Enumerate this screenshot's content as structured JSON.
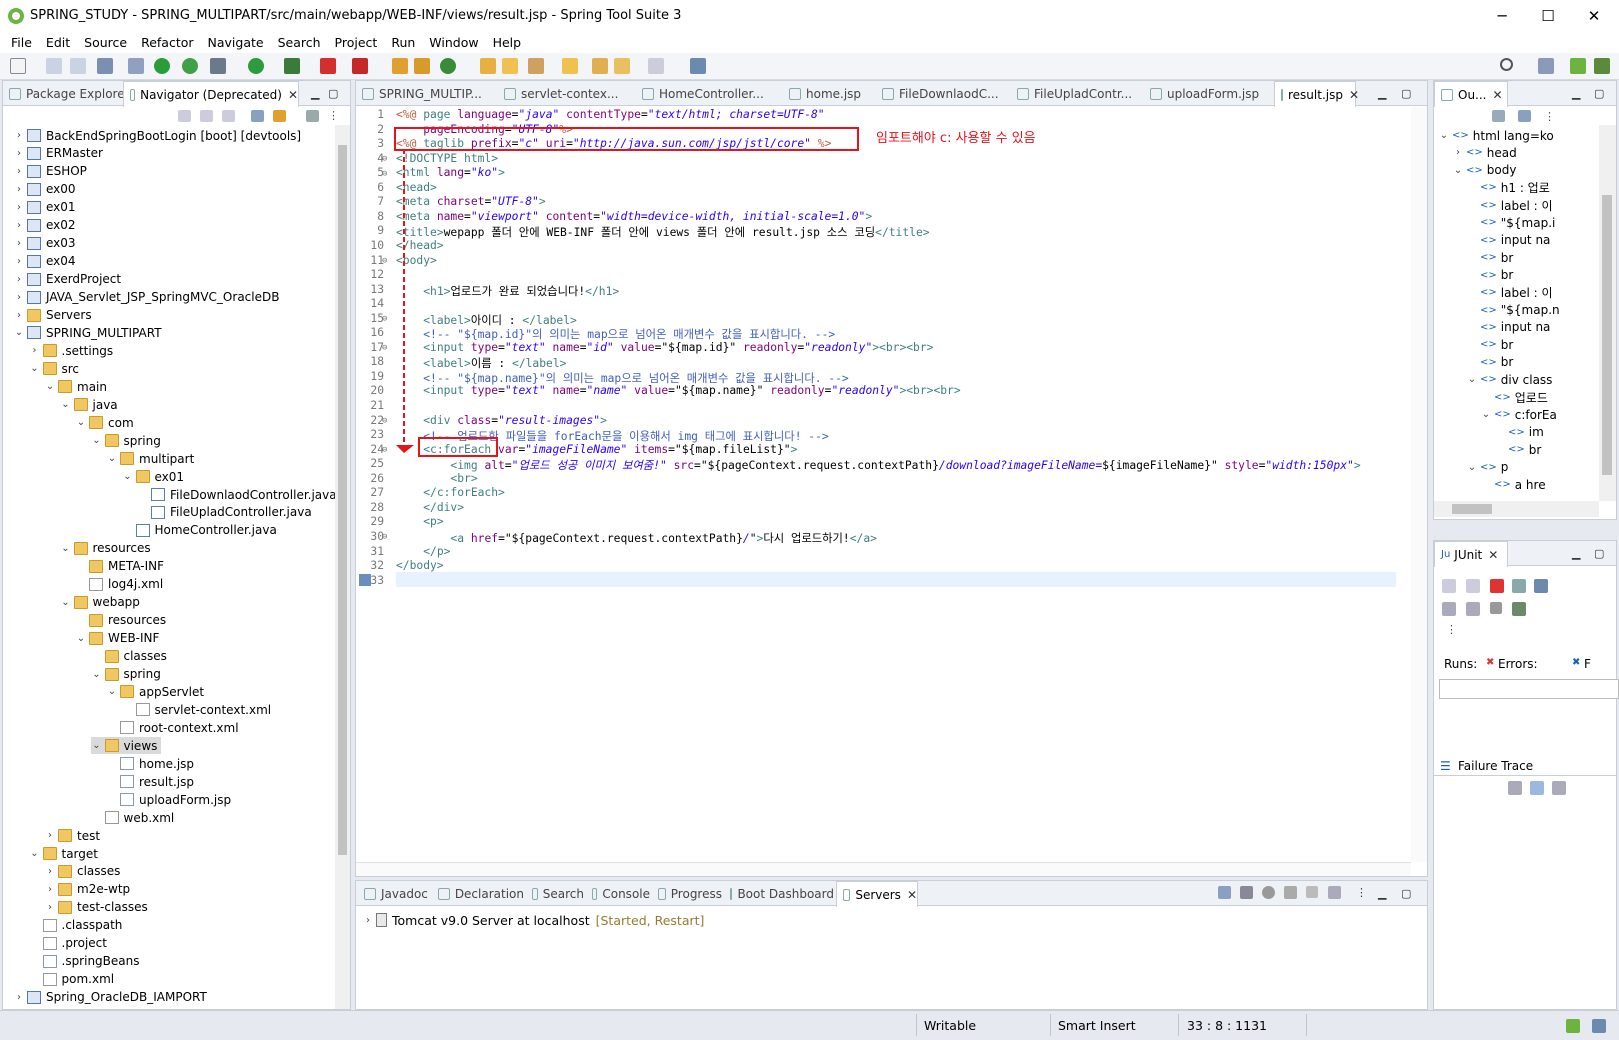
{
  "window": {
    "title": "SPRING_STUDY - SPRING_MULTIPART/src/main/webapp/WEB-INF/views/result.jsp - Spring Tool Suite 3",
    "min": "─",
    "max": "☐",
    "close": "✕"
  },
  "menu": [
    "File",
    "Edit",
    "Source",
    "Refactor",
    "Navigate",
    "Search",
    "Project",
    "Run",
    "Window",
    "Help"
  ],
  "left_panel": {
    "tabs": [
      {
        "label": "Package Explorer"
      },
      {
        "label": "Navigator (Deprecated)"
      }
    ],
    "tree": [
      {
        "label": "BackEndSpringBootLogin [boot] [devtools]",
        "depth": 0,
        "icon": "proj",
        "chev": "›"
      },
      {
        "label": "ERMaster",
        "depth": 0,
        "icon": "proj",
        "chev": "›"
      },
      {
        "label": "ESHOP",
        "depth": 0,
        "icon": "proj",
        "chev": "›"
      },
      {
        "label": "ex00",
        "depth": 0,
        "icon": "proj",
        "chev": "›"
      },
      {
        "label": "ex01",
        "depth": 0,
        "icon": "proj",
        "chev": "›"
      },
      {
        "label": "ex02",
        "depth": 0,
        "icon": "proj",
        "chev": "›"
      },
      {
        "label": "ex03",
        "depth": 0,
        "icon": "proj",
        "chev": "›"
      },
      {
        "label": "ex04",
        "depth": 0,
        "icon": "proj",
        "chev": "›"
      },
      {
        "label": "ExerdProject",
        "depth": 0,
        "icon": "proj",
        "chev": "›"
      },
      {
        "label": "JAVA_Servlet_JSP_SpringMVC_OracleDB",
        "depth": 0,
        "icon": "proj",
        "chev": "›"
      },
      {
        "label": "Servers",
        "depth": 0,
        "icon": "folder",
        "chev": "›"
      },
      {
        "label": "SPRING_MULTIPART",
        "depth": 0,
        "icon": "proj",
        "chev": "⌄"
      },
      {
        "label": ".settings",
        "depth": 1,
        "icon": "folder",
        "chev": "›"
      },
      {
        "label": "src",
        "depth": 1,
        "icon": "folder",
        "chev": "⌄"
      },
      {
        "label": "main",
        "depth": 2,
        "icon": "folder",
        "chev": "⌄"
      },
      {
        "label": "java",
        "depth": 3,
        "icon": "folder",
        "chev": "⌄"
      },
      {
        "label": "com",
        "depth": 4,
        "icon": "folder",
        "chev": "⌄"
      },
      {
        "label": "spring",
        "depth": 5,
        "icon": "folder",
        "chev": "⌄"
      },
      {
        "label": "multipart",
        "depth": 6,
        "icon": "folder",
        "chev": "⌄"
      },
      {
        "label": "ex01",
        "depth": 7,
        "icon": "folder",
        "chev": "⌄"
      },
      {
        "label": "FileDownlaodController.java",
        "depth": 8,
        "icon": "java",
        "chev": ""
      },
      {
        "label": "FileUpladController.java",
        "depth": 8,
        "icon": "java",
        "chev": ""
      },
      {
        "label": "HomeController.java",
        "depth": 7,
        "icon": "java",
        "chev": ""
      },
      {
        "label": "resources",
        "depth": 3,
        "icon": "folder",
        "chev": "⌄"
      },
      {
        "label": "META-INF",
        "depth": 4,
        "icon": "folder",
        "chev": ""
      },
      {
        "label": "log4j.xml",
        "depth": 4,
        "icon": "xml",
        "chev": ""
      },
      {
        "label": "webapp",
        "depth": 3,
        "icon": "folder",
        "chev": "⌄"
      },
      {
        "label": "resources",
        "depth": 4,
        "icon": "folder",
        "chev": ""
      },
      {
        "label": "WEB-INF",
        "depth": 4,
        "icon": "folder",
        "chev": "⌄"
      },
      {
        "label": "classes",
        "depth": 5,
        "icon": "folder",
        "chev": ""
      },
      {
        "label": "spring",
        "depth": 5,
        "icon": "folder",
        "chev": "⌄"
      },
      {
        "label": "appServlet",
        "depth": 6,
        "icon": "folder",
        "chev": "⌄"
      },
      {
        "label": "servlet-context.xml",
        "depth": 7,
        "icon": "xml",
        "chev": ""
      },
      {
        "label": "root-context.xml",
        "depth": 6,
        "icon": "xml",
        "chev": ""
      },
      {
        "label": "views",
        "depth": 5,
        "icon": "folder",
        "chev": "⌄",
        "selected": true
      },
      {
        "label": "home.jsp",
        "depth": 6,
        "icon": "file",
        "chev": ""
      },
      {
        "label": "result.jsp",
        "depth": 6,
        "icon": "file",
        "chev": ""
      },
      {
        "label": "uploadForm.jsp",
        "depth": 6,
        "icon": "file",
        "chev": ""
      },
      {
        "label": "web.xml",
        "depth": 5,
        "icon": "xml",
        "chev": ""
      },
      {
        "label": "test",
        "depth": 2,
        "icon": "folder",
        "chev": "›"
      },
      {
        "label": "target",
        "depth": 1,
        "icon": "folder",
        "chev": "⌄"
      },
      {
        "label": "classes",
        "depth": 2,
        "icon": "folder",
        "chev": "›"
      },
      {
        "label": "m2e-wtp",
        "depth": 2,
        "icon": "folder",
        "chev": "›"
      },
      {
        "label": "test-classes",
        "depth": 2,
        "icon": "folder",
        "chev": "›"
      },
      {
        "label": ".classpath",
        "depth": 1,
        "icon": "xml",
        "chev": ""
      },
      {
        "label": ".project",
        "depth": 1,
        "icon": "xml",
        "chev": ""
      },
      {
        "label": ".springBeans",
        "depth": 1,
        "icon": "file",
        "chev": ""
      },
      {
        "label": "pom.xml",
        "depth": 1,
        "icon": "xml",
        "chev": ""
      },
      {
        "label": "Spring_OracleDB_IAMPORT",
        "depth": 0,
        "icon": "proj",
        "chev": "›"
      }
    ]
  },
  "editor": {
    "tabs": [
      "SPRING_MULTIP...",
      "servlet-contex...",
      "HomeController...",
      "home.jsp",
      "FileDownlaodC...",
      "FileUpladContr...",
      "uploadForm.jsp",
      "result.jsp"
    ],
    "active_tab": "result.jsp",
    "annotation": "임포트해야 c: 사용할 수 있음",
    "annotation_color": "#e8121b",
    "lines": [
      {
        "n": "1",
        "html": "<span class='jsp'>&lt;%@</span> <span class='tag'>page</span> <span class='attr'>language</span>=<span class='str'>\"java\"</span> <span class='attr'>contentType</span>=<span class='str'>\"text/html; charset=UTF-8\"</span>"
      },
      {
        "n": "2",
        "html": "    <span class='attr'>pageEncoding</span>=<span class='str'>\"UTF-8\"</span><span class='jsp'>%&gt;</span>"
      },
      {
        "n": "3",
        "html": "<span class='jsp'>&lt;%@</span> <span class='tag'>taglib</span> <span class='attr'>prefix</span>=<span class='str'>\"c\"</span> <span class='attr'>uri</span>=<span class='str'>\"http://java.sun.com/jsp/jstl/core\"</span> <span class='jsp'>%&gt;</span>"
      },
      {
        "n": "4",
        "html": "<span class='tag'>&lt;!DOCTYPE html&gt;</span>"
      },
      {
        "n": "5",
        "html": "<span class='tag'>&lt;html</span> <span class='attr'>lang</span>=<span class='str'>\"ko\"</span><span class='tag'>&gt;</span>"
      },
      {
        "n": "6",
        "html": "<span class='tag'>&lt;head&gt;</span>"
      },
      {
        "n": "7",
        "html": "<span class='tag'>&lt;meta</span> <span class='attr'>charset</span>=<span class='str'>\"UTF-8\"</span><span class='tag'>&gt;</span>"
      },
      {
        "n": "8",
        "html": "<span class='tag'>&lt;meta</span> <span class='attr'>name</span>=<span class='str'>\"viewport\"</span> <span class='attr'>content</span>=<span class='str'>\"width=device-width, initial-scale=1.0\"</span><span class='tag'>&gt;</span>"
      },
      {
        "n": "9",
        "html": "<span class='tag'>&lt;title&gt;</span>wepapp 폴더 안에 WEB-INF 폴더 안에 views 폴더 안에 result.jsp 소스 코딩<span class='tag'>&lt;/title&gt;</span>"
      },
      {
        "n": "10",
        "html": "<span class='tag'>&lt;/head&gt;</span>"
      },
      {
        "n": "11",
        "html": "<span class='tag'>&lt;body&gt;</span>"
      },
      {
        "n": "12",
        "html": ""
      },
      {
        "n": "13",
        "html": "    <span class='tag'>&lt;h1&gt;</span>업로드가 완료 되었습니다!<span class='tag'>&lt;/h1&gt;</span>"
      },
      {
        "n": "14",
        "html": ""
      },
      {
        "n": "15",
        "html": "    <span class='tag'>&lt;label&gt;</span>아이디 : <span class='tag'>&lt;/label&gt;</span>"
      },
      {
        "n": "16",
        "html": "    <span class='cmt'>&lt;!-- \"${map.id}\"의 의미는 map으로 넘어온 매개변수 값을 표시합니다. --&gt;</span>"
      },
      {
        "n": "17",
        "html": "    <span class='tag'>&lt;input</span> <span class='attr'>type</span>=<span class='str'>\"text\"</span> <span class='attr'>name</span>=<span class='str'>\"id\"</span> <span class='attr'>value</span>=\"${map.id}\" <span class='attr'>readonly</span>=<span class='str'>\"readonly\"</span><span class='tag'>&gt;&lt;br&gt;&lt;br&gt;</span>"
      },
      {
        "n": "18",
        "html": "    <span class='tag'>&lt;label&gt;</span>이름 : <span class='tag'>&lt;/label&gt;</span>"
      },
      {
        "n": "19",
        "html": "    <span class='cmt'>&lt;!-- \"${map.name}\"의 의미는 map으로 넘어온 매개변수 값을 표시합니다. --&gt;</span>"
      },
      {
        "n": "20",
        "html": "    <span class='tag'>&lt;input</span> <span class='attr'>type</span>=<span class='str'>\"text\"</span> <span class='attr'>name</span>=<span class='str'>\"name\"</span> <span class='attr'>value</span>=\"${map.name}\" <span class='attr'>readonly</span>=<span class='str'>\"readonly\"</span><span class='tag'>&gt;&lt;br&gt;&lt;br&gt;</span>"
      },
      {
        "n": "21",
        "html": ""
      },
      {
        "n": "22",
        "html": "    <span class='tag'>&lt;div</span> <span class='attr'>class</span>=<span class='str'>\"result-images\"</span><span class='tag'>&gt;</span>"
      },
      {
        "n": "23",
        "html": "    <span class='cmt'>&lt;!-- 업로드한 파일들을 forEach문을 이용해서 img 태그에 표시합니다! --&gt;</span>"
      },
      {
        "n": "24",
        "html": "    <span class='tag'>&lt;c:forEach</span> <span class='attr'>var</span>=<span class='str'>\"imageFileName\"</span> <span class='attr'>items</span>=\"${map.fileList}\"<span class='tag'>&gt;</span>"
      },
      {
        "n": "25",
        "html": "        <span class='tag'>&lt;img</span> <span class='attr'>alt</span>=<span class='str'>\"업로드 성공 이미지 보여줌!\"</span> <span class='attr'>src</span>=\"${pageContext.request.contextPath}<span class='str'>/download?imageFileName=</span>${imageFileName}\" <span class='attr'>style</span>=<span class='str'>\"width:150px\"</span><span class='tag'>&gt;</span>"
      },
      {
        "n": "26",
        "html": "        <span class='tag'>&lt;br&gt;</span>"
      },
      {
        "n": "27",
        "html": "    <span class='tag'>&lt;/c:forEach&gt;</span>"
      },
      {
        "n": "28",
        "html": "    <span class='tag'>&lt;/div&gt;</span>"
      },
      {
        "n": "29",
        "html": "    <span class='tag'>&lt;p&gt;</span>"
      },
      {
        "n": "30",
        "html": "        <span class='tag'>&lt;a</span> <span class='attr'>href</span>=\"${pageContext.request.contextPath}<span class='str'>/</span>\"<span class='tag'>&gt;</span>다시 업로드하기!<span class='tag'>&lt;/a&gt;</span>"
      },
      {
        "n": "31",
        "html": "    <span class='tag'>&lt;/p&gt;</span>"
      },
      {
        "n": "32",
        "html": "<span class='tag'>&lt;/body&gt;</span>"
      },
      {
        "n": "33",
        "html": "<span class='tag'>&lt;/html&gt;</span>"
      }
    ]
  },
  "outline": {
    "tab": "Ou...",
    "items": [
      {
        "label": "html lang=ko",
        "depth": 0,
        "chev": "⌄"
      },
      {
        "label": "head",
        "depth": 1,
        "chev": "›"
      },
      {
        "label": "body",
        "depth": 1,
        "chev": "⌄"
      },
      {
        "label": "h1 : 업로",
        "depth": 2,
        "chev": ""
      },
      {
        "label": "label : 이",
        "depth": 2,
        "chev": ""
      },
      {
        "label": "\"${map.i",
        "depth": 2,
        "chev": ""
      },
      {
        "label": "input na",
        "depth": 2,
        "chev": ""
      },
      {
        "label": "br",
        "depth": 2,
        "chev": ""
      },
      {
        "label": "br",
        "depth": 2,
        "chev": ""
      },
      {
        "label": "label : 이",
        "depth": 2,
        "chev": ""
      },
      {
        "label": "\"${map.n",
        "depth": 2,
        "chev": ""
      },
      {
        "label": "input na",
        "depth": 2,
        "chev": ""
      },
      {
        "label": "br",
        "depth": 2,
        "chev": ""
      },
      {
        "label": "br",
        "depth": 2,
        "chev": ""
      },
      {
        "label": "div class",
        "depth": 2,
        "chev": "⌄"
      },
      {
        "label": "업로드",
        "depth": 3,
        "chev": ""
      },
      {
        "label": "c:forEa",
        "depth": 3,
        "chev": "⌄"
      },
      {
        "label": "im",
        "depth": 4,
        "chev": ""
      },
      {
        "label": "br",
        "depth": 4,
        "chev": ""
      },
      {
        "label": "p",
        "depth": 2,
        "chev": "⌄"
      },
      {
        "label": "a hre",
        "depth": 3,
        "chev": ""
      }
    ]
  },
  "junit": {
    "tab": "JUnit",
    "runs": "Runs:",
    "errors": "Errors:",
    "failures": "F",
    "failure_trace": "Failure Trace"
  },
  "bottom": {
    "tabs": [
      "Javadoc",
      "Declaration",
      "Search",
      "Console",
      "Progress",
      "Boot Dashboard",
      "Servers"
    ],
    "active_tab": "Servers",
    "server_label": "Tomcat v9.0 Server at localhost",
    "server_status": "[Started, Restart]"
  },
  "status": {
    "writable": "Writable",
    "insert": "Smart Insert",
    "position": "33 : 8 : 1131"
  }
}
